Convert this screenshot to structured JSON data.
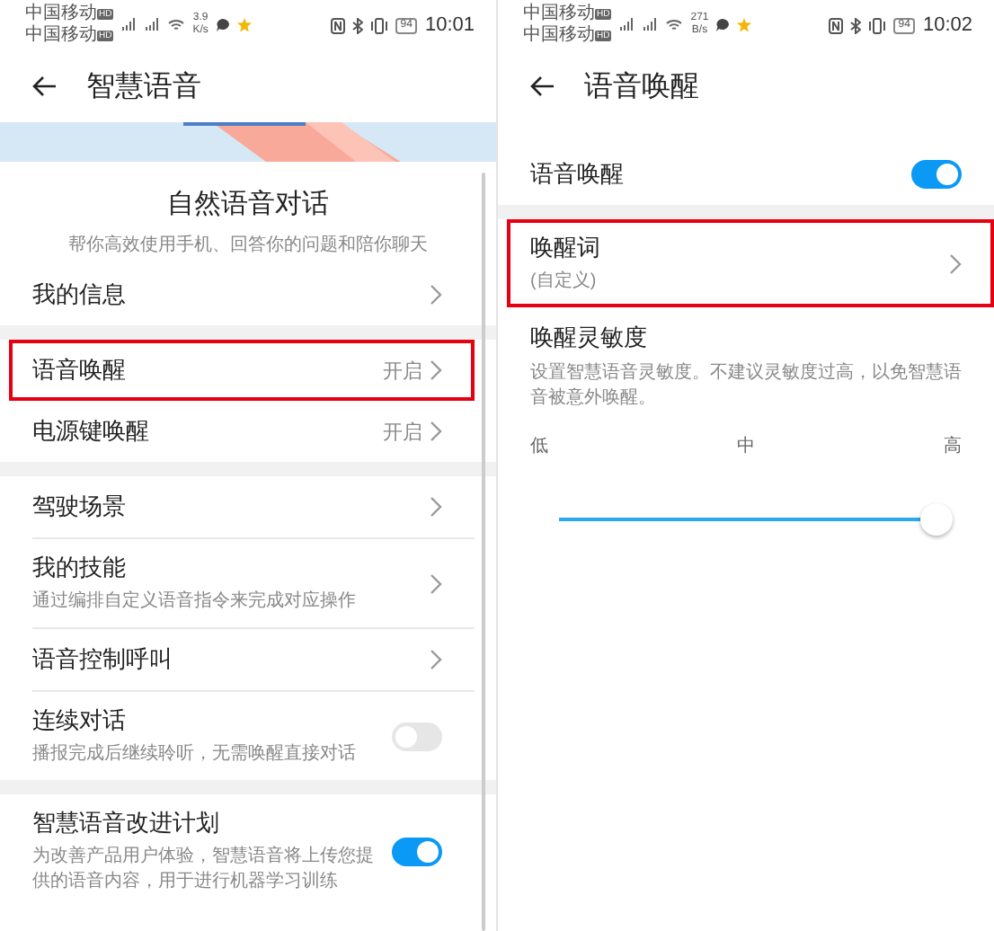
{
  "screens": [
    {
      "status_bar": {
        "carriers": [
          {
            "name": "中国移动",
            "badge": "HD"
          },
          {
            "name": "中国移动",
            "badge": "HD"
          }
        ],
        "speed": "3.9",
        "speed_unit": "K/s",
        "battery": "94",
        "time": "10:01"
      },
      "title": "智慧语音",
      "scrollbar": true,
      "groups": [
        {
          "items": [
            {
              "kind": "intro",
              "label": "自然语音对话",
              "subtitle": "帮你高效使用手机、回答你的问题和陪你聊天"
            },
            {
              "kind": "nav",
              "label": "我的信息",
              "highlighted": false
            }
          ]
        },
        {
          "items": [
            {
              "kind": "nav",
              "label": "语音唤醒",
              "value": "开启",
              "highlighted": true
            },
            {
              "kind": "nav",
              "label": "电源键唤醒",
              "value": "开启",
              "highlighted": false
            }
          ]
        },
        {
          "items": [
            {
              "kind": "nav",
              "label": "驾驶场景",
              "highlighted": false
            },
            {
              "kind": "nav",
              "label": "我的技能",
              "subtitle": "通过编排自定义语音指令来完成对应操作",
              "highlighted": false
            },
            {
              "kind": "nav",
              "label": "语音控制呼叫",
              "highlighted": false
            },
            {
              "kind": "toggle",
              "label": "连续对话",
              "subtitle": "播报完成后继续聆听，无需唤醒直接对话",
              "on": false
            }
          ]
        },
        {
          "items": [
            {
              "kind": "toggle",
              "label": "智慧语音改进计划",
              "subtitle": "为改善产品用户体验，智慧语音将上传您提供的语音内容，用于进行机器学习训练",
              "on": true
            }
          ]
        }
      ]
    },
    {
      "status_bar": {
        "carriers": [
          {
            "name": "中国移动",
            "badge": "HD"
          },
          {
            "name": "中国移动",
            "badge": "HD"
          }
        ],
        "speed": "271",
        "speed_unit": "B/s",
        "battery": "94",
        "time": "10:02"
      },
      "title": "语音唤醒",
      "groups": [
        {
          "items": [
            {
              "kind": "toggle",
              "label": "语音唤醒",
              "on": true
            }
          ]
        },
        {
          "items": [
            {
              "kind": "nav",
              "label": "唤醒词",
              "subtitle": "(自定义)",
              "highlighted": true
            },
            {
              "kind": "slider",
              "label": "唤醒灵敏度",
              "subtitle": "设置智慧语音灵敏度。不建议灵敏度过高，以免智慧语音被意外唤醒。",
              "ticks": [
                "低",
                "中",
                "高"
              ],
              "level": 1
            }
          ]
        }
      ]
    }
  ]
}
